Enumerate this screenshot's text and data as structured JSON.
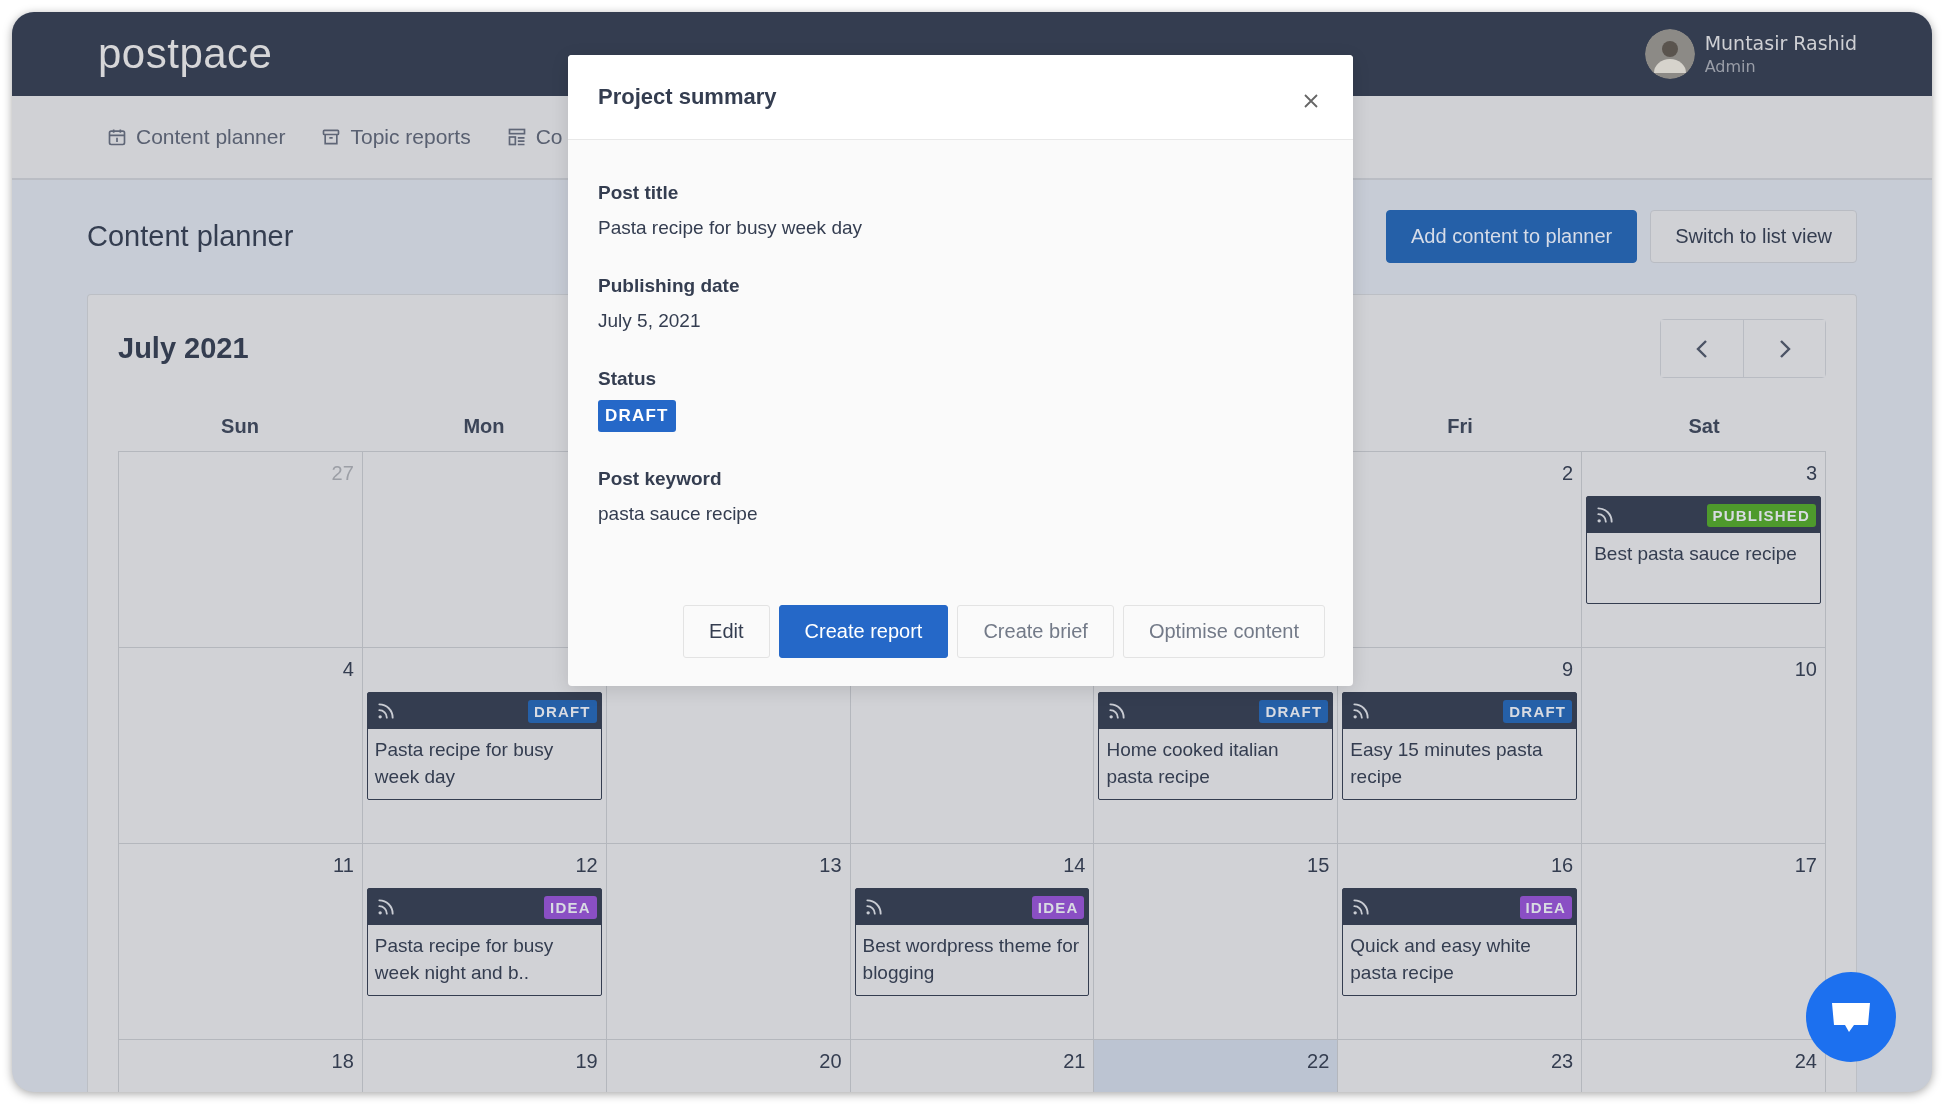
{
  "header": {
    "logo": "postpace",
    "user": {
      "name": "Muntasir Rashid",
      "role": "Admin"
    }
  },
  "nav": [
    {
      "label": "Content planner"
    },
    {
      "label": "Topic reports"
    },
    {
      "label": "Co"
    }
  ],
  "page": {
    "title": "Content planner",
    "buttons": [
      {
        "label": "Add content to planner",
        "kind": "primary"
      },
      {
        "label": "Switch to list view",
        "kind": "secondary"
      }
    ]
  },
  "calendar": {
    "month": "July 2021",
    "days": [
      {
        "label": "Sun"
      },
      {
        "label": "Mon"
      },
      {
        "label": "Fri"
      },
      {
        "label": "Sat"
      }
    ],
    "weeks": [
      {
        "cells": [
          {
            "date": "27",
            "other_month": true,
            "today": false
          },
          {
            "today": false
          },
          null,
          null,
          null,
          {
            "date": "2",
            "other_month": false,
            "today": false
          },
          {
            "date": "3",
            "other_month": false,
            "today": false,
            "event": {
              "title": "Best pasta sauce recipe",
              "kind": "published",
              "badge": "PUBLISHED"
            }
          }
        ]
      },
      {
        "cells": [
          {
            "date": "4",
            "other_month": false,
            "today": false
          },
          {
            "today": false,
            "event": {
              "title": "Pasta recipe for busy week day",
              "kind": "draft",
              "badge": "DRAFT"
            }
          },
          {
            "today": false
          },
          {
            "today": false
          },
          {
            "today": false,
            "event": {
              "title": "Home cooked italian pasta recipe",
              "kind": "draft",
              "badge": "DRAFT"
            }
          },
          {
            "date": "9",
            "other_month": false,
            "today": false,
            "event": {
              "title": "Easy 15 minutes pasta recipe",
              "kind": "draft",
              "badge": "DRAFT"
            }
          },
          {
            "date": "10",
            "other_month": false,
            "today": false
          }
        ]
      },
      {
        "cells": [
          {
            "date": "11",
            "other_month": false,
            "today": false
          },
          {
            "date": "12",
            "other_month": false,
            "today": false,
            "event": {
              "title": "Pasta recipe for busy week night and b..",
              "kind": "idea",
              "badge": "IDEA"
            }
          },
          {
            "date": "13",
            "other_month": false,
            "today": false
          },
          {
            "date": "14",
            "other_month": false,
            "today": false,
            "event": {
              "title": "Best wordpress theme for blogging",
              "kind": "idea",
              "badge": "IDEA"
            }
          },
          {
            "date": "15",
            "other_month": false,
            "today": false
          },
          {
            "date": "16",
            "other_month": false,
            "today": false,
            "event": {
              "title": "Quick and easy white pasta recipe",
              "kind": "idea",
              "badge": "IDEA"
            }
          },
          {
            "date": "17",
            "other_month": false,
            "today": false
          }
        ]
      },
      {
        "cells": [
          {
            "date": "18",
            "other_month": false,
            "today": false
          },
          {
            "date": "19",
            "other_month": false,
            "today": false
          },
          {
            "date": "20",
            "other_month": false,
            "today": false
          },
          {
            "date": "21",
            "other_month": false,
            "today": false
          },
          {
            "date": "22",
            "other_month": false,
            "today": true
          },
          {
            "date": "23",
            "other_month": false,
            "today": false
          },
          {
            "date": "24",
            "other_month": false,
            "today": false
          }
        ]
      }
    ]
  },
  "modal": {
    "title": "Project summary",
    "fields": [
      {
        "label": "Post title",
        "value": "Pasta recipe for busy week day",
        "kind": "text"
      },
      {
        "label": "Publishing date",
        "value": "July 5, 2021",
        "kind": "text"
      },
      {
        "label": "Status",
        "value": "DRAFT",
        "kind": "badge"
      },
      {
        "label": "Post keyword",
        "value": "pasta sauce recipe",
        "kind": "text"
      }
    ],
    "buttons": [
      {
        "label": "Edit",
        "kind": "secondary"
      },
      {
        "label": "Create report",
        "kind": "primary"
      },
      {
        "label": "Create brief",
        "kind": "muted"
      },
      {
        "label": "Optimise content",
        "kind": "muted"
      }
    ]
  }
}
